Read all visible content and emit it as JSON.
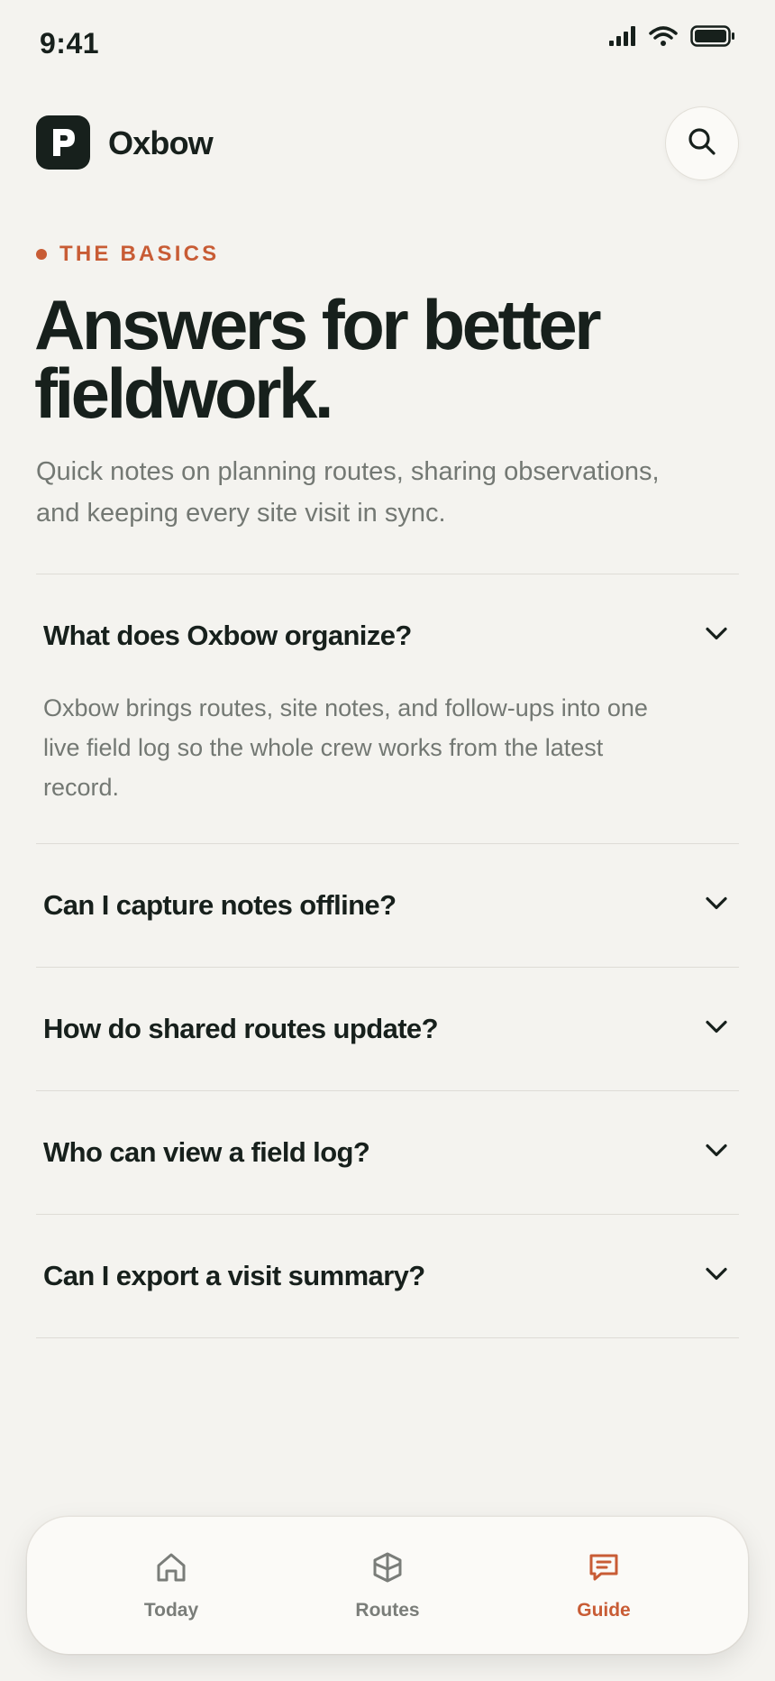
{
  "status_bar": {
    "time": "9:41",
    "icons": [
      "signal-icon",
      "wifi-icon",
      "battery-icon"
    ]
  },
  "header": {
    "app_name": "Oxbow",
    "logo_icon": "oxbow-logo-icon",
    "search_icon": "search-icon"
  },
  "hero": {
    "eyebrow": "THE BASICS",
    "title": "Answers for better fieldwork.",
    "subtitle": "Quick notes on planning routes, sharing observations, and keeping every site visit in sync."
  },
  "faq": {
    "items": [
      {
        "question": "What does Oxbow organize?",
        "answer": "Oxbow brings routes, site notes, and follow-ups into one live field log so the whole crew works from the latest record.",
        "expanded": true
      },
      {
        "question": "Can I capture notes offline?",
        "expanded": false
      },
      {
        "question": "How do shared routes update?",
        "expanded": false
      },
      {
        "question": "Who can view a field log?",
        "expanded": false
      },
      {
        "question": "Can I export a visit summary?",
        "expanded": false
      }
    ]
  },
  "bottom_nav": {
    "items": [
      {
        "label": "Today",
        "icon": "home-icon",
        "active": false
      },
      {
        "label": "Routes",
        "icon": "map-icon",
        "active": false
      },
      {
        "label": "Guide",
        "icon": "chat-icon",
        "active": true
      }
    ]
  },
  "colors": {
    "background": "#f4f3ef",
    "ink": "#17201c",
    "accent": "#c85c35",
    "muted": "#737873",
    "divider": "#dedcd6"
  }
}
